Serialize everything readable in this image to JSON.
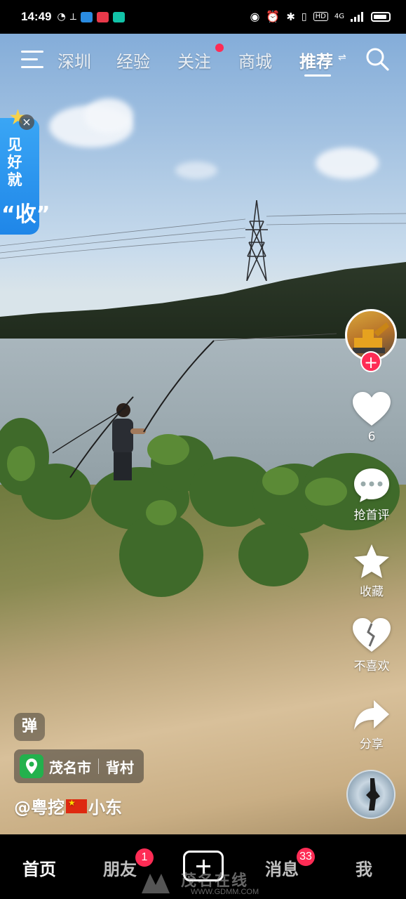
{
  "status_bar": {
    "time": "14:49",
    "network_label": "4G",
    "hd_label": "HD"
  },
  "top_nav": {
    "tabs": [
      {
        "label": "深圳",
        "active": false
      },
      {
        "label": "经验",
        "active": false
      },
      {
        "label": "关注",
        "active": false,
        "has_dot": true
      },
      {
        "label": "商城",
        "active": false
      },
      {
        "label": "推荐",
        "active": true
      }
    ]
  },
  "promo": {
    "text": "见好就",
    "big": "“收”"
  },
  "side_actions": {
    "like_count": "6",
    "comment_label": "抢首评",
    "favorite_label": "收藏",
    "dislike_label": "不喜欢",
    "share_label": "分享"
  },
  "overlay": {
    "danmu_label": "弹",
    "location_city": "茂名市",
    "location_place": "背村",
    "author_prefix": "@粤挖",
    "author_suffix": "小东"
  },
  "bottom_nav": {
    "home": "首页",
    "friends": "朋友",
    "friends_badge": "1",
    "messages": "消息",
    "messages_badge": "33",
    "me": "我"
  },
  "watermark": {
    "text": "茂名在线",
    "url": "WWW.GDMM.COM"
  },
  "colors": {
    "accent": "#fe2c55",
    "promo_blue": "#1f86e8",
    "location_green": "#23b14d"
  }
}
